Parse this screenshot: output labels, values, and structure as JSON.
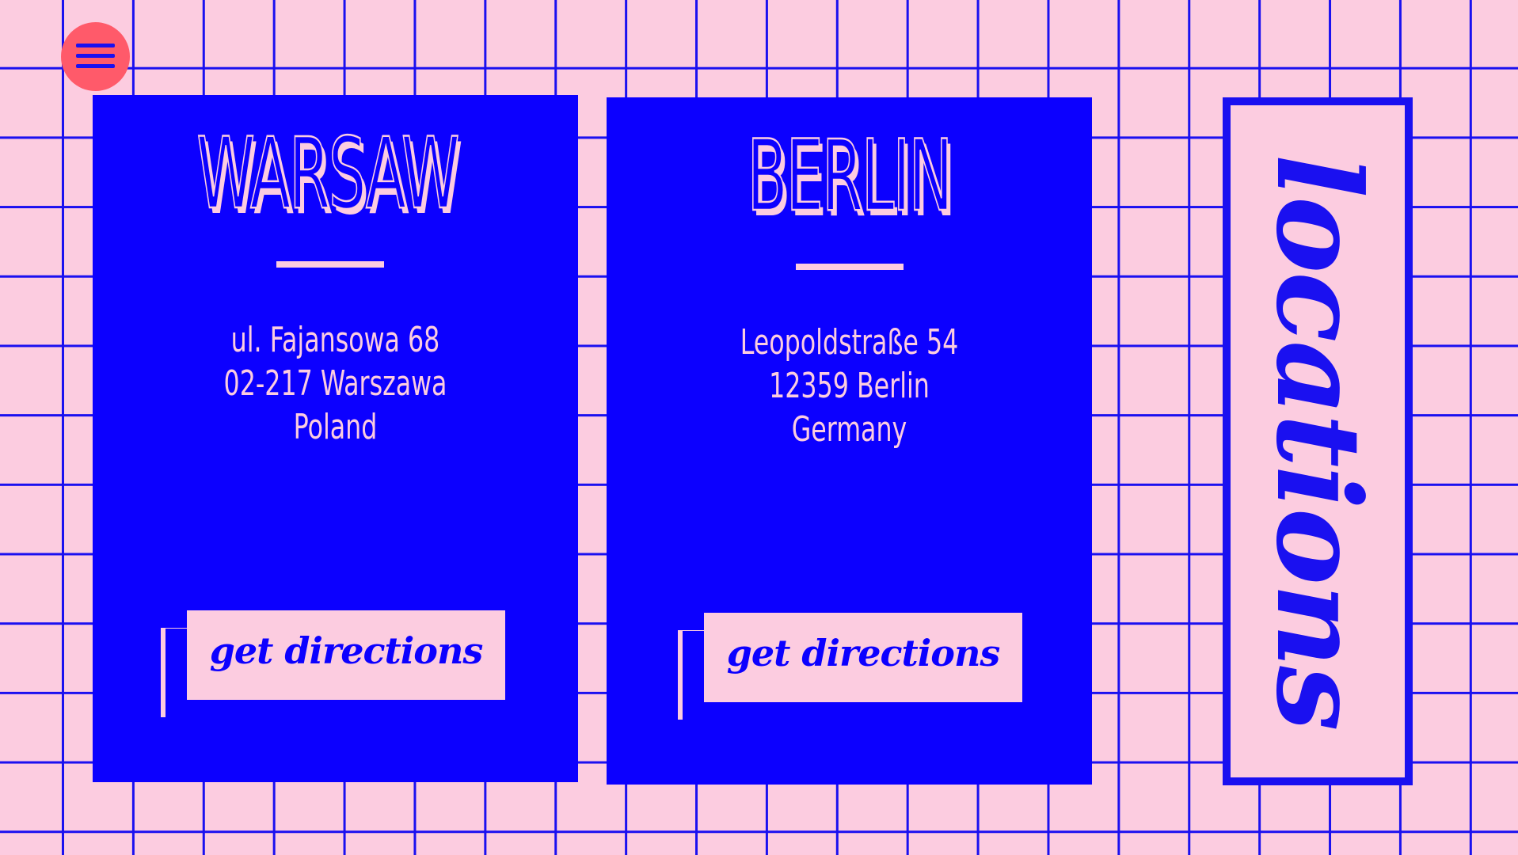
{
  "menu": {
    "icon": "hamburger-menu-icon"
  },
  "cards": [
    {
      "city": "WARSAW",
      "address_lines": [
        "ul. Fajansowa 68",
        "02-217 Warszawa",
        "Poland"
      ],
      "button_label": "get directions"
    },
    {
      "city": "BERLIN",
      "address_lines": [
        "Leopoldstraße 54",
        "12359 Berlin",
        "Germany"
      ],
      "button_label": "get directions"
    }
  ],
  "side_panel": {
    "label": "locations"
  },
  "colors": {
    "background": "#fccce0",
    "grid": "#1a10f0",
    "card": "#0c00ff",
    "menu_button": "#ff5a6a",
    "text_light": "#fccce0"
  }
}
